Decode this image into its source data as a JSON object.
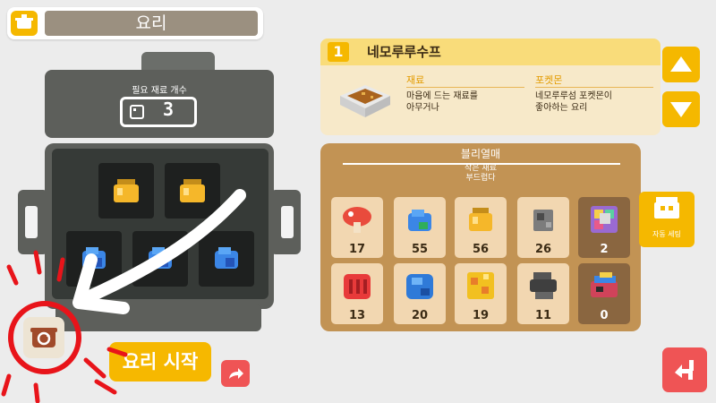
{
  "header": {
    "title": "요리"
  },
  "pot": {
    "required_label": "필요 재료 개수",
    "required_count": "3"
  },
  "start_button": {
    "label": "요리 시작"
  },
  "recipe": {
    "number": "1",
    "name": "네모루루수프",
    "ingredients_title": "재료",
    "ingredients_text": "마음에 드는 재료를\n아무거나",
    "pokemon_title": "포켓몬",
    "pokemon_text": "네모루루섬 포켓몬이\n좋아하는 요리"
  },
  "ingredient_panel": {
    "title": "블리열매",
    "subtitle": "작은 재료\n부드럽다",
    "items": [
      {
        "name": "mushroom-icon",
        "count": "17",
        "color": "#e94b3c"
      },
      {
        "name": "blue-crystal-icon",
        "count": "55",
        "color": "#3b86e6"
      },
      {
        "name": "honey-icon",
        "count": "56",
        "color": "#f5b72a"
      },
      {
        "name": "stone-icon",
        "count": "26",
        "color": "#7c7c7c"
      },
      {
        "name": "rainbow-mineral-icon",
        "count": "2",
        "color": "#9a6ad1"
      },
      {
        "name": "big-red-icon",
        "count": "13",
        "color": "#e83a3a"
      },
      {
        "name": "big-blue-icon",
        "count": "20",
        "color": "#2f7ad8"
      },
      {
        "name": "big-honey-icon",
        "count": "19",
        "color": "#f2c020"
      },
      {
        "name": "big-stone-icon",
        "count": "11",
        "color": "#555555"
      },
      {
        "name": "rainbow-crystal-icon",
        "count": "0",
        "color": "#d0435a"
      }
    ]
  },
  "auto_button": {
    "label": "자동 세팅"
  },
  "colors": {
    "accent": "#f5b800",
    "danger": "#ef5455",
    "annotation": "#e8141a"
  }
}
